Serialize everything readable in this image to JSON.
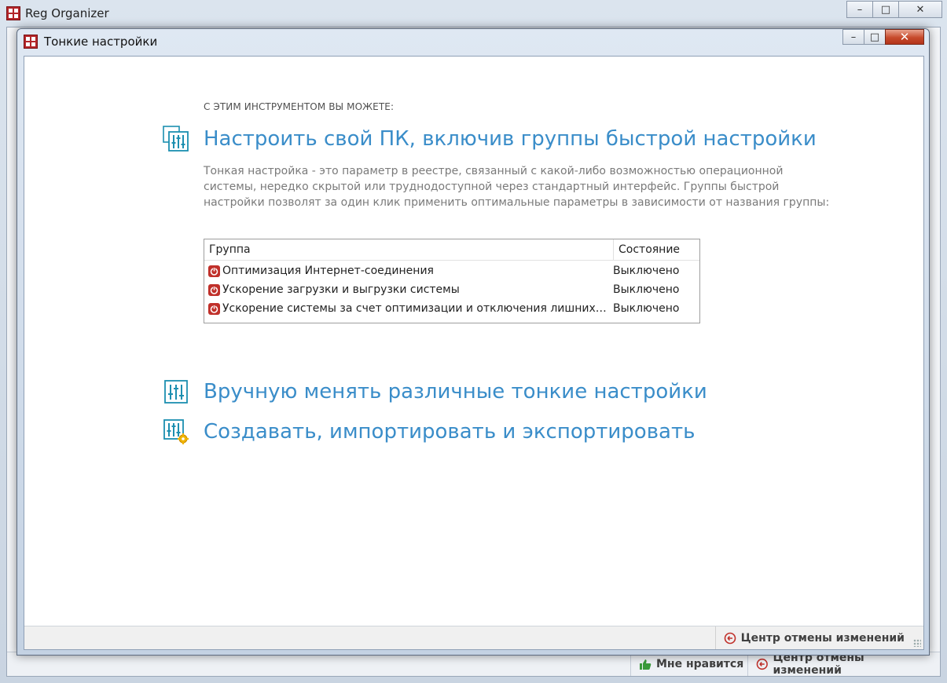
{
  "app": {
    "title": "Reg Organizer",
    "status_like": "Мне нравится",
    "status_undo": "Центр отмены изменений"
  },
  "dialog": {
    "title": "Тонкие настройки",
    "intro_caps": "С ЭТИМ ИНСТРУМЕНТОМ ВЫ МОЖЕТЕ:",
    "section1_title": "Настроить свой ПК, включив группы быстрой настройки",
    "section1_desc": "Тонкая настройка - это параметр в реестре, связанный с какой-либо возможностью операционной системы, нередко скрытой или труднодоступной через стандартный интерфейс. Группы быстрой настройки позволят за один клик применить оптимальные параметры в зависимости от названия группы:",
    "table": {
      "col_group": "Группа",
      "col_state": "Состояние",
      "rows": [
        {
          "name": "Оптимизация Интернет-соединения",
          "state": "Выключено"
        },
        {
          "name": "Ускорение загрузки и выгрузки системы",
          "state": "Выключено"
        },
        {
          "name": "Ускорение системы за счет оптимизации и отключения лишних фун...",
          "state": "Выключено"
        }
      ]
    },
    "section2_title": "Вручную менять различные тонкие настройки",
    "section3_title": "Создавать, импортировать и экспортировать",
    "status_undo": "Центр отмены изменений"
  },
  "colors": {
    "link_blue": "#3a8dc9",
    "icon_teal": "#1c8fb0",
    "off_red": "#c0302a",
    "close_red": "#c74a2c"
  }
}
